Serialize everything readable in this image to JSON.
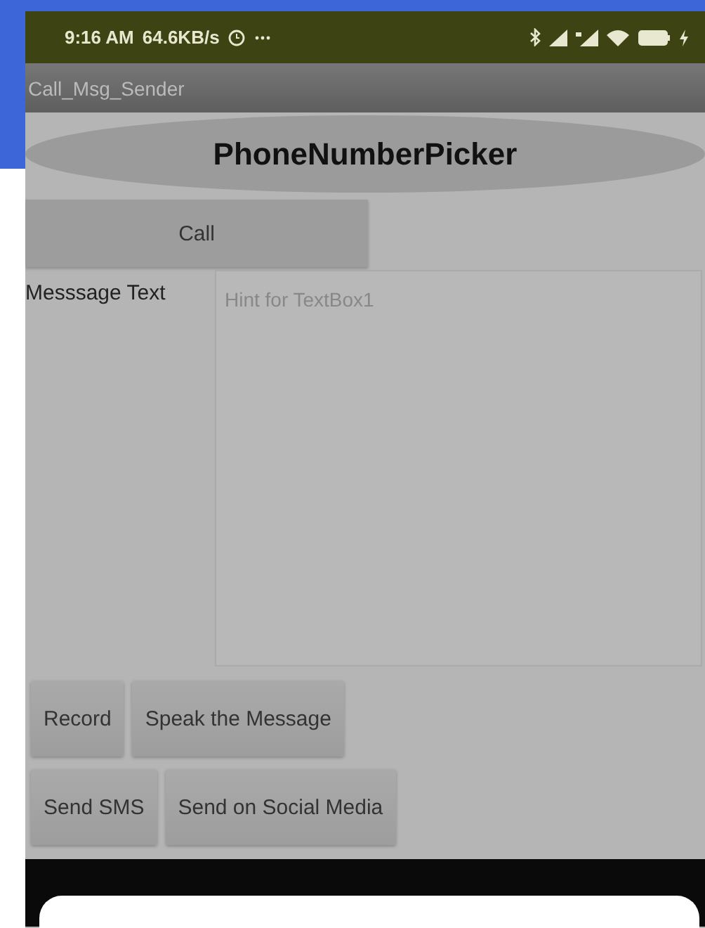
{
  "status_bar": {
    "time": "9:16 AM",
    "speed": "64.6KB/s"
  },
  "title_bar": {
    "title": "Call_Msg_Sender"
  },
  "picker": {
    "label": "PhoneNumberPicker"
  },
  "call_button": {
    "label": "Call"
  },
  "message": {
    "label": "Messsage Text",
    "placeholder": "Hint for TextBox1"
  },
  "button_rows": [
    [
      "Record",
      "Speak the Message"
    ],
    [
      "Send SMS",
      "Send on Social Media"
    ]
  ]
}
